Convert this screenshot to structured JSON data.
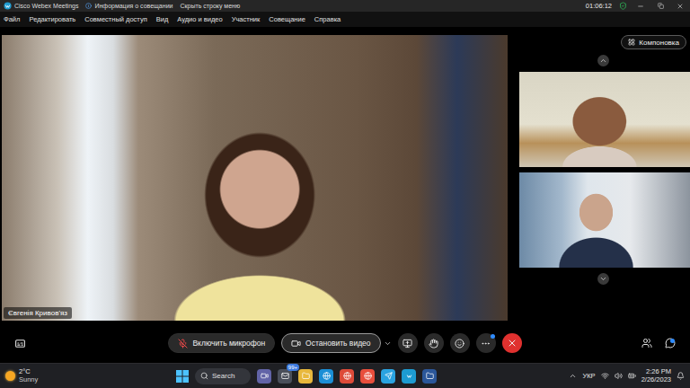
{
  "window": {
    "title": "Cisco Webex Meetings",
    "links": [
      {
        "label": "Информация о совещании",
        "kind": "info"
      },
      {
        "label": "Скрыть строку меню",
        "kind": "plain"
      }
    ],
    "timer": "01:06:12"
  },
  "menu": [
    "Файл",
    "Редактировать",
    "Совместный доступ",
    "Вид",
    "Аудио и видео",
    "Участник",
    "Совещание",
    "Справка"
  ],
  "layout_button": {
    "label": "Компоновка"
  },
  "main_video": {
    "name": "Євгенія Кривов'яз"
  },
  "thumbnails": [
    {
      "kind": "warm"
    },
    {
      "kind": "cool"
    }
  ],
  "controls": [
    {
      "label": "Включить микрофон",
      "kind": "mic",
      "muted": true
    },
    {
      "label": "Остановить видео",
      "kind": "camera",
      "muted": false
    }
  ],
  "taskbar": {
    "weather": {
      "temp": "2°C",
      "condition": "Sunny"
    },
    "search": {
      "placeholder": "Search"
    },
    "badge": "99+",
    "language": "УКР",
    "time": "2:26 PM",
    "date": "2/26/2023"
  }
}
